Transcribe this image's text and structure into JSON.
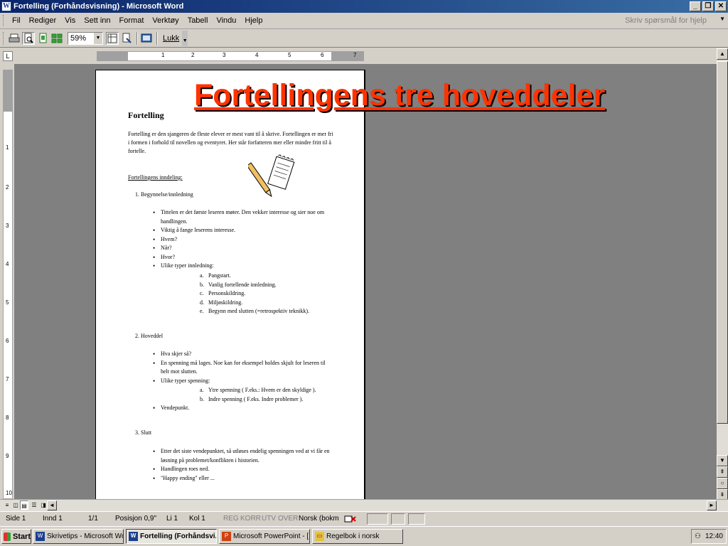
{
  "window": {
    "title": "Fortelling (Forhåndsvisning) - Microsoft Word",
    "app_icon_letter": "W"
  },
  "menu": {
    "items": [
      "Fil",
      "Rediger",
      "Vis",
      "Sett inn",
      "Format",
      "Verktøy",
      "Tabell",
      "Vindu",
      "Hjelp"
    ],
    "help_placeholder": "Skriv spørsmål for hjelp"
  },
  "toolbar": {
    "zoom": "59%",
    "close_label": "Lukk"
  },
  "ruler": {
    "h_numbers": [
      "1",
      "2",
      "3",
      "4",
      "5",
      "6",
      "7"
    ],
    "v_numbers": [
      "1",
      "2",
      "3",
      "4",
      "5",
      "6",
      "7",
      "8",
      "9",
      "10"
    ]
  },
  "slide_title": "Fortellingens tre hoveddeler",
  "document": {
    "heading": "Fortelling",
    "intro": "Fortelling er den sjangeren de fleste elever er mest vant til å skrive. Fortellingen er mer fri i formen i forhold til novellen og eventyret. Her står forfatteren mer eller mindre fritt til å fortelle.",
    "subheading": "Fortellingens inndeling:",
    "sections": [
      {
        "title": "1.  Begynnelse/innledning",
        "bullets": [
          "Tittelen er det første leseren møter. Den vekker interesse og sier noe om handlingen.",
          "Viktig å fange leserens interesse.",
          "Hvem?",
          "Når?",
          "Hvor?",
          "Ulike typer innledning:"
        ],
        "sublist": [
          {
            "letter": "a.",
            "text": "Pangstart."
          },
          {
            "letter": "b.",
            "text": "Vanlig fortellende innledning."
          },
          {
            "letter": "c.",
            "text": "Personskildring."
          },
          {
            "letter": "d.",
            "text": "Miljøskildring."
          },
          {
            "letter": "e.",
            "text": "Begynn med slutten (=retrospektiv teknikk)."
          }
        ]
      },
      {
        "title": "2.  Hoveddel",
        "bullets": [
          "Hva skjer så?",
          "En spenning må lages. Noe kan for eksempel holdes skjult for leseren til helt mot slutten.",
          "Ulike typer spenning:"
        ],
        "sublist": [
          {
            "letter": "a.",
            "text": "Ytre spenning ( F.eks.: Hvem er den skyldige )."
          },
          {
            "letter": "b.",
            "text": "Indre spenning ( F.eks. Indre problemer )."
          }
        ],
        "bullets_after": [
          "Vendepunkt."
        ]
      },
      {
        "title": "3.  Slutt",
        "bullets": [
          "Etter det siste vendepunktet, så utløses endelig spenningen ved at vi får en løsning på problemet/konflikten i historien.",
          "Handlingen roes ned.",
          "\"Happy ending\" eller ..."
        ]
      }
    ]
  },
  "status": {
    "page": "Side  1",
    "section": "Innd  1",
    "pages": "1/1",
    "position": "Posisjon  0,9\"",
    "line": "Li  1",
    "column": "Kol  1",
    "modes": [
      "REG",
      "KORR",
      "UTV",
      "OVER"
    ],
    "language": "Norsk (bokm"
  },
  "taskbar": {
    "start": "Start",
    "tasks": [
      "Skrivetips - Microsoft Word",
      "Fortelling (Forhåndsvi...",
      "Microsoft PowerPoint - [...",
      "Regelbok i norsk"
    ],
    "clock": "12:40"
  }
}
